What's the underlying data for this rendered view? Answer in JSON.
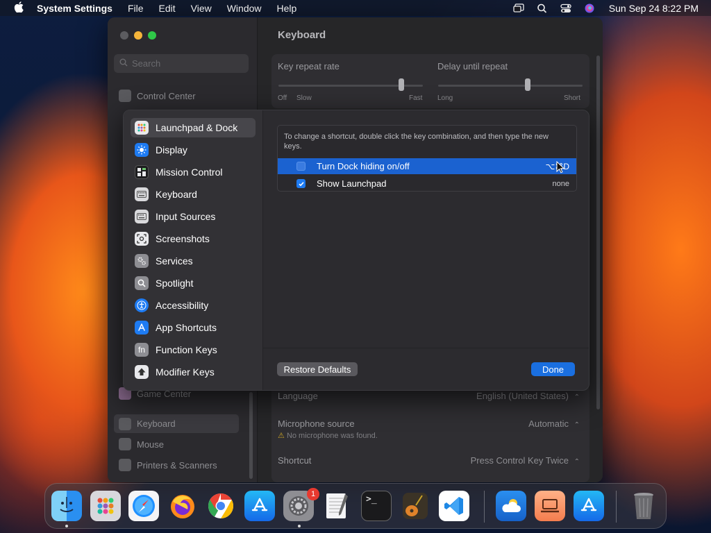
{
  "menubar": {
    "app_name": "System Settings",
    "menus": [
      "File",
      "Edit",
      "View",
      "Window",
      "Help"
    ],
    "clock": "Sun Sep 24  8:22 PM"
  },
  "window": {
    "title": "Keyboard",
    "search_placeholder": "Search",
    "sidebar_items": {
      "control_center": "Control Center",
      "game_center": "Game Center",
      "keyboard": "Keyboard",
      "mouse": "Mouse",
      "printers": "Printers & Scanners"
    },
    "key_repeat": {
      "label": "Key repeat rate",
      "left_a": "Off",
      "left_b": "Slow",
      "right": "Fast",
      "level": 0.85
    },
    "delay_repeat": {
      "label": "Delay until repeat",
      "left": "Long",
      "right": "Short",
      "level": 0.62
    },
    "dictation_rows": {
      "language_label": "Language",
      "language_value": "English (United States)",
      "mic_label": "Microphone source",
      "mic_value": "Automatic",
      "mic_warning": "No microphone was found.",
      "shortcut_label": "Shortcut",
      "shortcut_value": "Press Control Key Twice"
    }
  },
  "sheet": {
    "categories": [
      {
        "label": "Launchpad & Dock",
        "icon": "launchpad-icon"
      },
      {
        "label": "Display",
        "icon": "display-icon"
      },
      {
        "label": "Mission Control",
        "icon": "mission-control-icon"
      },
      {
        "label": "Keyboard",
        "icon": "keyboard-icon"
      },
      {
        "label": "Input Sources",
        "icon": "input-sources-icon"
      },
      {
        "label": "Screenshots",
        "icon": "screenshots-icon"
      },
      {
        "label": "Services",
        "icon": "services-icon"
      },
      {
        "label": "Spotlight",
        "icon": "spotlight-icon"
      },
      {
        "label": "Accessibility",
        "icon": "accessibility-icon"
      },
      {
        "label": "App Shortcuts",
        "icon": "app-shortcuts-icon"
      },
      {
        "label": "Function Keys",
        "icon": "function-keys-icon"
      },
      {
        "label": "Modifier Keys",
        "icon": "modifier-keys-icon"
      }
    ],
    "hint": "To change a shortcut, double click the key combination, and then type the new keys.",
    "shortcuts": [
      {
        "label": "Turn Dock hiding on/off",
        "key": "⌥⌘D",
        "checked": false,
        "selected": true
      },
      {
        "label": "Show Launchpad",
        "key": "none",
        "checked": true,
        "selected": false
      }
    ],
    "restore_label": "Restore Defaults",
    "done_label": "Done"
  },
  "dock": {
    "badge_count": "1",
    "apps": [
      "Finder",
      "Launchpad",
      "Safari",
      "Firefox",
      "Chrome",
      "App Store",
      "System Settings",
      "TextEdit",
      "Terminal",
      "GarageBand",
      "VS Code",
      "Weather",
      "Screen Sharing",
      "App Store",
      "Trash"
    ]
  },
  "colors": {
    "accent": "#1b62d0",
    "done_button": "#1a6fe0"
  }
}
